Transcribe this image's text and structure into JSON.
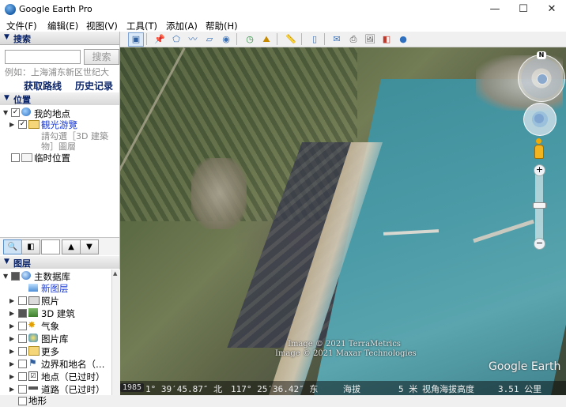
{
  "window": {
    "title": "Google Earth Pro",
    "minimize": "—",
    "maximize": "☐",
    "close": "✕"
  },
  "menu": [
    "文件(F)",
    "编辑(E)",
    "视图(V)",
    "工具(T)",
    "添加(A)",
    "帮助(H)"
  ],
  "search": {
    "header": "搜索",
    "input_value": "",
    "button": "搜索",
    "example": "例如：上海浦东新区世纪大",
    "route_link": "获取路线",
    "history_link": "历史记录"
  },
  "places": {
    "header": "位置",
    "my_places": "我的地点",
    "sightseeing": "観光游覽",
    "hint_line1": "請勾選［3D 建築",
    "hint_line2": "物］圖層",
    "temp_places": "临时位置"
  },
  "layers": {
    "header": "图层",
    "items": [
      {
        "label": "主数据库",
        "icon": "globe-icon"
      },
      {
        "label": "新图层",
        "icon": "layer-icon"
      },
      {
        "label": "照片",
        "icon": "photo-icon"
      },
      {
        "label": "3D 建筑",
        "icon": "building-icon"
      },
      {
        "label": "气象",
        "icon": "sun-icon"
      },
      {
        "label": "图片库",
        "icon": "gallery-icon"
      },
      {
        "label": "更多",
        "icon": "more-icon"
      },
      {
        "label": "边界和地名（…",
        "icon": "flag-icon"
      },
      {
        "label": "地点（已过时）",
        "icon": "places-icon"
      },
      {
        "label": "道路（已过时）",
        "icon": "road-icon"
      },
      {
        "label": "地形",
        "icon": "terrain-icon"
      }
    ]
  },
  "map": {
    "credit1": "Image © 2021 TerraMetrics",
    "credit2": "Image © 2021 Maxar Technologies",
    "logo": "Google Earth",
    "compass_n": "N"
  },
  "status": {
    "year": "1985",
    "lat": "1°  39′45.87″  北",
    "lon": "117°  25′36.42″  东",
    "elevation_label": "海拔",
    "elevation": "5  米",
    "eye_label": "视角海拔高度",
    "eye_alt": "3.51  公里"
  }
}
